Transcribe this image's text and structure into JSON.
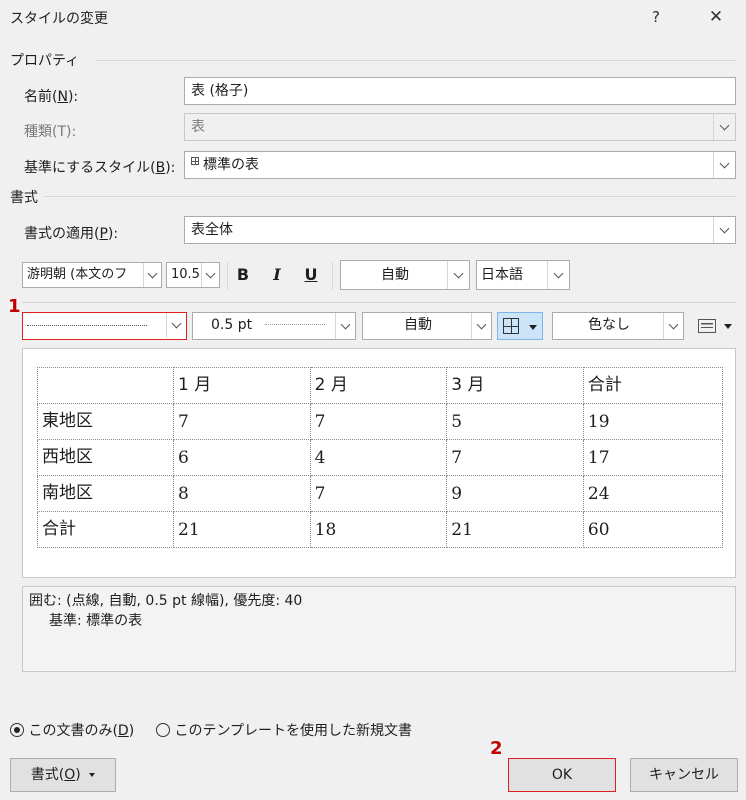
{
  "window": {
    "title": "スタイルの変更",
    "help_label": "?",
    "close_label": "✕"
  },
  "properties": {
    "section_label": "プロパティ",
    "name": {
      "label_pre": "名前(",
      "label_key": "N",
      "label_post": "):",
      "value": "表 (格子)"
    },
    "type": {
      "label": "種類(T):",
      "value": "表"
    },
    "base": {
      "label_pre": "基準にするスタイル(",
      "label_key": "B",
      "label_post": "):",
      "value": "標準の表"
    }
  },
  "format": {
    "section_label": "書式",
    "apply": {
      "label_pre": "書式の適用(",
      "label_key": "P",
      "label_post": "):",
      "value": "表全体"
    },
    "font_name": "游明朝 (本文のフ",
    "font_size": "10.5",
    "bold_label": "B",
    "italic_label": "I",
    "underline_label": "U",
    "font_color": "自動",
    "language": "日本語",
    "border_weight": "0.5 pt",
    "border_color": "自動",
    "shading": "色なし"
  },
  "preview": {
    "rows": [
      [
        "",
        "1 月",
        "2 月",
        "3 月",
        "合計"
      ],
      [
        "東地区",
        "7",
        "7",
        "5",
        "19"
      ],
      [
        "西地区",
        "6",
        "4",
        "7",
        "17"
      ],
      [
        "南地区",
        "8",
        "7",
        "9",
        "24"
      ],
      [
        "合計",
        "21",
        "18",
        "21",
        "60"
      ]
    ]
  },
  "description": {
    "line1": "囲む: (点線, 自動,  0.5 pt 線幅), 優先度: 40",
    "line2": "基準: 標準の表"
  },
  "scope": {
    "option1_pre": "この文書のみ(",
    "option1_key": "D",
    "option1_post": ")",
    "option2": "このテンプレートを使用した新規文書"
  },
  "buttons": {
    "format_pre": "書式(",
    "format_key": "O",
    "format_post": ")",
    "ok": "OK",
    "cancel": "キャンセル"
  },
  "annotations": {
    "step1": "1",
    "step2": "2"
  },
  "colors": {
    "highlight": "#e02020",
    "selected_button": "#cce4f7"
  }
}
